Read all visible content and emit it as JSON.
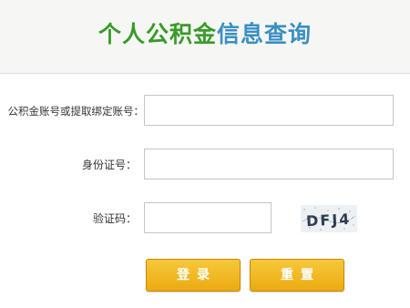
{
  "header": {
    "title_part1": "个人公积金",
    "title_part2": "信息查询"
  },
  "form": {
    "account_label": "公积金账号或提取绑定账号：",
    "account_value": "",
    "id_label": "身份证号：",
    "id_value": "",
    "captcha_label": "验证码：",
    "captcha_value": "",
    "captcha_text": "DFJ4"
  },
  "buttons": {
    "login_label": "登录",
    "reset_label": "重置"
  },
  "colors": {
    "title_green": "#3a9a2a",
    "title_blue": "#3a8fc4",
    "button_gold": "#ebaa12"
  }
}
